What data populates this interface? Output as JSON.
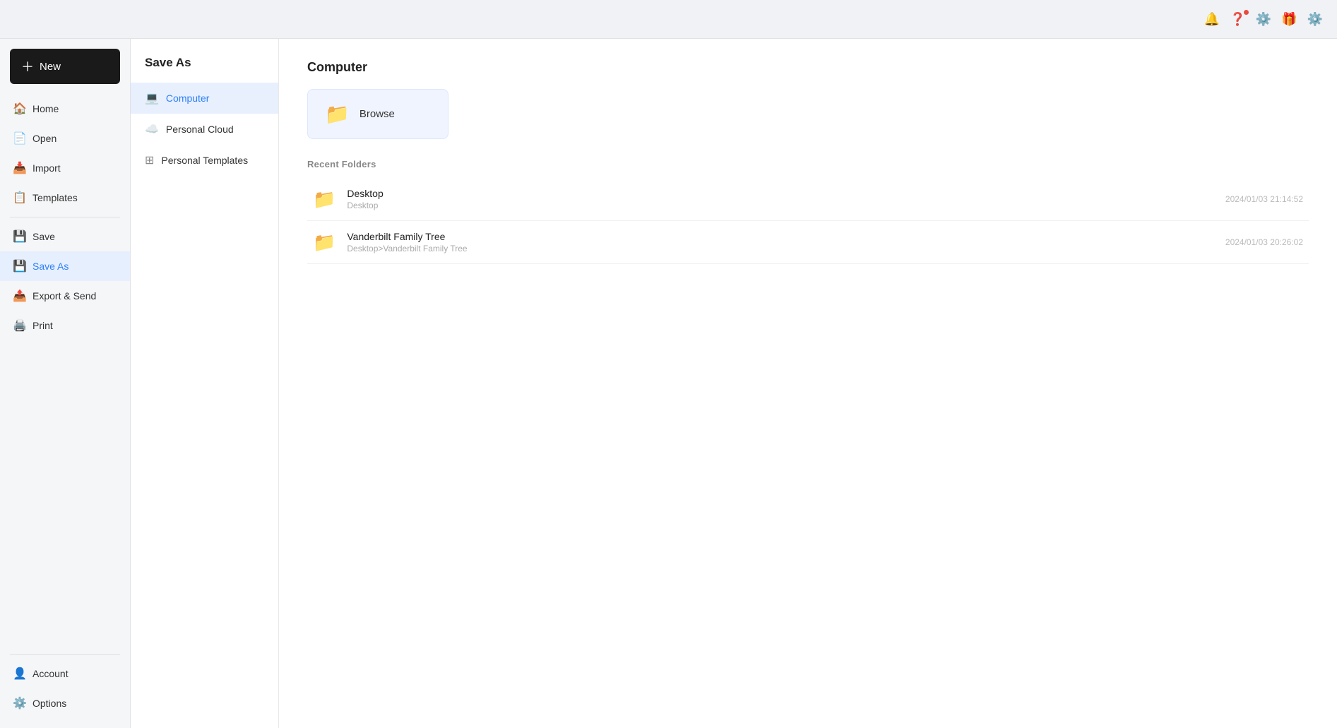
{
  "topbar": {
    "icons": [
      "bell",
      "question",
      "apps",
      "gift",
      "settings"
    ]
  },
  "sidebar": {
    "new_label": "New",
    "items": [
      {
        "id": "home",
        "label": "Home",
        "icon": "🏠"
      },
      {
        "id": "open",
        "label": "Open",
        "icon": "📄"
      },
      {
        "id": "import",
        "label": "Import",
        "icon": "📥"
      },
      {
        "id": "templates",
        "label": "Templates",
        "icon": "📋"
      },
      {
        "id": "save",
        "label": "Save",
        "icon": "💾"
      },
      {
        "id": "save-as",
        "label": "Save As",
        "icon": "💾",
        "active": true
      },
      {
        "id": "export-send",
        "label": "Export & Send",
        "icon": "📤"
      },
      {
        "id": "print",
        "label": "Print",
        "icon": "🖨️"
      }
    ],
    "bottom_items": [
      {
        "id": "account",
        "label": "Account",
        "icon": "👤"
      },
      {
        "id": "options",
        "label": "Options",
        "icon": "⚙️"
      }
    ]
  },
  "save_as_panel": {
    "title": "Save As",
    "items": [
      {
        "id": "computer",
        "label": "Computer",
        "icon": "💻",
        "active": true
      },
      {
        "id": "personal-cloud",
        "label": "Personal Cloud",
        "icon": "☁️"
      },
      {
        "id": "personal-templates",
        "label": "Personal Templates",
        "icon": "⊞"
      }
    ]
  },
  "content": {
    "title": "Computer",
    "browse_label": "Browse",
    "recent_folders_label": "Recent Folders",
    "folders": [
      {
        "name": "Desktop",
        "path": "Desktop",
        "date": "2024/01/03 21:14:52"
      },
      {
        "name": "Vanderbilt Family Tree",
        "path": "Desktop>Vanderbilt Family Tree",
        "date": "2024/01/03 20:26:02"
      }
    ]
  }
}
